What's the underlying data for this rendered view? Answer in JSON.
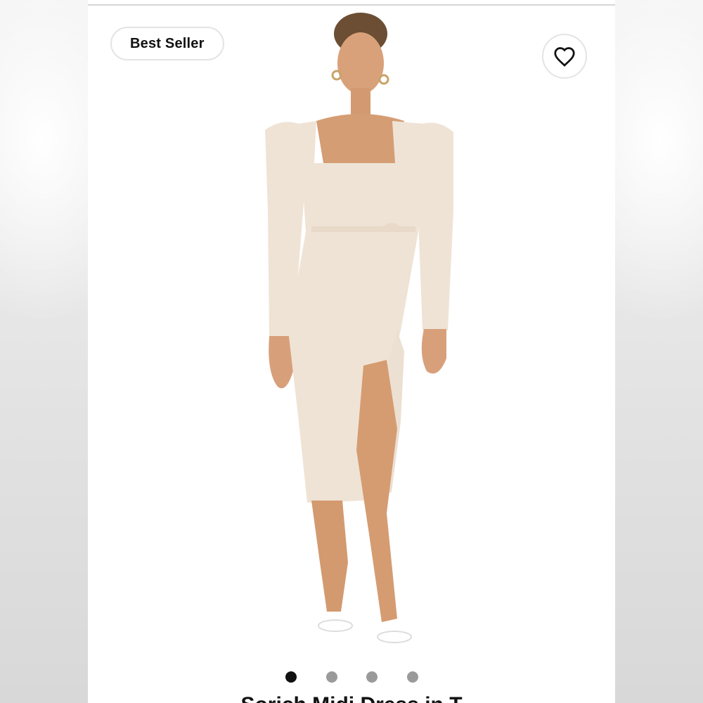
{
  "badge": {
    "label": "Best Seller"
  },
  "favorite": {
    "icon": "heart-icon"
  },
  "product": {
    "title": "Sorich Midi Dress in T"
  },
  "carousel": {
    "count": 4,
    "active_index": 0
  },
  "colors": {
    "dress": "#efe3d6",
    "skin": "#d79c72",
    "dot_active": "#111111",
    "dot_inactive": "#9a9a9a"
  }
}
